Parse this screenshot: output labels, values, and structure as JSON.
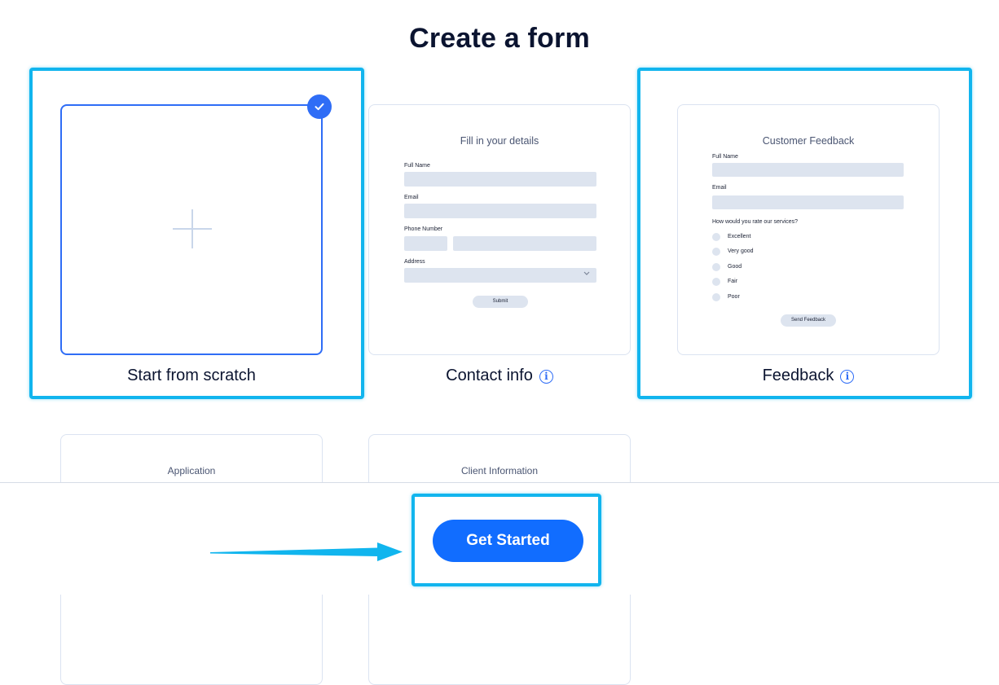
{
  "page": {
    "title": "Create a form"
  },
  "cards": {
    "scratch": {
      "label": "Start from scratch",
      "selected": true
    },
    "contact": {
      "label": "Contact info",
      "preview": {
        "title": "Fill in your details",
        "full_name": "Full Name",
        "email": "Email",
        "phone": "Phone Number",
        "address": "Address",
        "submit": "Submit"
      }
    },
    "feedback": {
      "label": "Feedback",
      "preview": {
        "title": "Customer Feedback",
        "full_name": "Full Name",
        "email": "Email",
        "question": "How would you rate our services?",
        "options": [
          "Excellent",
          "Very good",
          "Good",
          "Fair",
          "Poor"
        ],
        "button": "Send Feedback"
      }
    },
    "application": {
      "preview_title": "Application"
    },
    "client": {
      "preview_title": "Client Information"
    }
  },
  "footer": {
    "cta": "Get Started"
  },
  "icons": {
    "selected": "check-icon",
    "add": "plus-icon",
    "info": "info-icon",
    "dropdown": "chevron-down-icon",
    "annotation": "arrow-right-icon"
  },
  "colors": {
    "accent": "#116dff",
    "highlight": "#11b5ee",
    "selected_border": "#2f6df6"
  }
}
